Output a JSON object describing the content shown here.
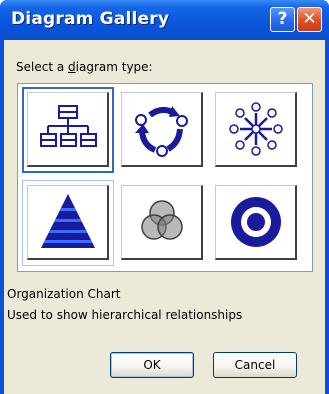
{
  "window": {
    "title": "Diagram Gallery",
    "help_glyph": "?",
    "close_glyph": "✕"
  },
  "prompt": {
    "before": "Select a ",
    "underlined": "d",
    "after": "iagram type:"
  },
  "diagram_types": [
    {
      "icon": "organization-chart-icon",
      "selected": true
    },
    {
      "icon": "cycle-diagram-icon",
      "selected": false
    },
    {
      "icon": "radial-diagram-icon",
      "selected": false
    },
    {
      "icon": "pyramid-diagram-icon",
      "selected": false
    },
    {
      "icon": "venn-diagram-icon",
      "selected": false
    },
    {
      "icon": "target-diagram-icon",
      "selected": false
    }
  ],
  "description": {
    "name": "Organization Chart",
    "text": "Used to show hierarchical relationships"
  },
  "buttons": {
    "ok": "OK",
    "cancel": "Cancel"
  },
  "colors": {
    "titlebar": "#0b52d8",
    "dialog_face": "#ece9d8",
    "icon_blue": "#1a1a9c",
    "selection": "#316ac5"
  }
}
